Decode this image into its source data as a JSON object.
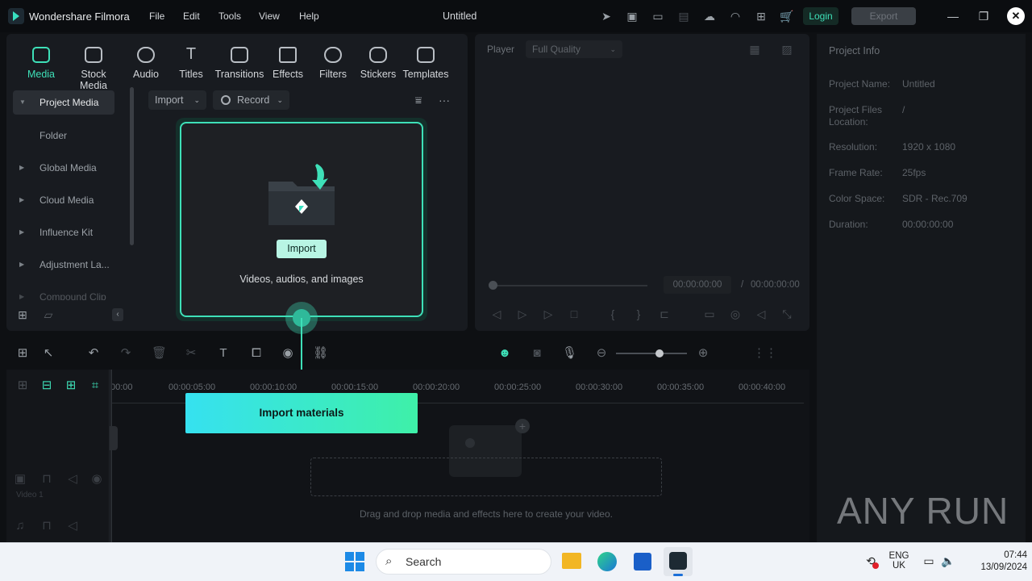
{
  "app": {
    "name": "Wondershare Filmora",
    "title": "Untitled"
  },
  "menu": [
    "File",
    "Edit",
    "Tools",
    "View",
    "Help"
  ],
  "header": {
    "login": "Login",
    "export": "Export"
  },
  "tabs": [
    {
      "label": "Media",
      "active": true
    },
    {
      "label": "Stock Media"
    },
    {
      "label": "Audio"
    },
    {
      "label": "Titles"
    },
    {
      "label": "Transitions"
    },
    {
      "label": "Effects"
    },
    {
      "label": "Filters"
    },
    {
      "label": "Stickers"
    },
    {
      "label": "Templates"
    }
  ],
  "sidebar": {
    "items": [
      {
        "label": "Project Media",
        "active": true
      },
      {
        "label": "Folder"
      },
      {
        "label": "Global Media"
      },
      {
        "label": "Cloud Media"
      },
      {
        "label": "Influence Kit"
      },
      {
        "label": "Adjustment La..."
      },
      {
        "label": "Compound Clip"
      }
    ]
  },
  "toolbar": {
    "import": "Import",
    "record": "Record"
  },
  "import_card": {
    "button": "Import",
    "description": "Videos, audios, and images"
  },
  "player": {
    "label": "Player",
    "quality": "Full Quality",
    "current_time": "00:00:00:00",
    "separator": "/",
    "total_time": "00:00:00:00"
  },
  "project_info": {
    "title": "Project Info",
    "rows": [
      {
        "key": "Project Name:",
        "value": "Untitled"
      },
      {
        "key": "Project Files Location:",
        "value": "/"
      },
      {
        "key": "Resolution:",
        "value": "1920 x 1080"
      },
      {
        "key": "Frame Rate:",
        "value": "25fps"
      },
      {
        "key": "Color Space:",
        "value": "SDR - Rec.709"
      },
      {
        "key": "Duration:",
        "value": "00:00:00:00"
      }
    ]
  },
  "timeline": {
    "ticks": [
      "00:00",
      "00:00:05:00",
      "00:00:10:00",
      "00:00:15:00",
      "00:00:20:00",
      "00:00:25:00",
      "00:00:30:00",
      "00:00:35:00",
      "00:00:40:00"
    ],
    "track_video": "Video 1",
    "callout": "Import materials",
    "drop_hint": "Drag and drop media and effects here to create your video."
  },
  "watermark": "ANY RUN",
  "taskbar": {
    "search": "Search",
    "lang1": "ENG",
    "lang2": "UK",
    "time": "07:44",
    "date": "13/09/2024"
  },
  "colors": {
    "accent": "#3ee0b8",
    "panel": "#181b20",
    "bg": "#0e1013"
  }
}
